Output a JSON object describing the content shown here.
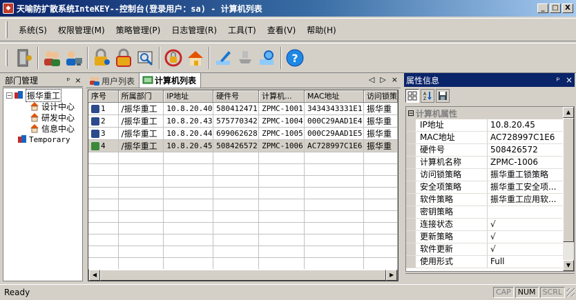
{
  "window": {
    "title": "天喻防扩散系统InteKEY--控制台(登录用户：sa) - 计算机列表",
    "minimize": "_",
    "maximize": "□",
    "close": "X"
  },
  "menu": {
    "items": [
      "系统(S)",
      "权限管理(M)",
      "策略管理(P)",
      "日志管理(R)",
      "工具(T)",
      "查看(V)",
      "帮助(H)"
    ]
  },
  "toolbar": {
    "icons": [
      "door-exit-icon",
      "users-icon",
      "user-computer-icon",
      "lock-key-icon",
      "lock-icon",
      "key-search-icon",
      "lock-refresh-icon",
      "home-lock-icon",
      "pen-edit-icon",
      "stamp-icon",
      "stamp-search-icon",
      "help-icon"
    ]
  },
  "dept_panel": {
    "title": "部门管理",
    "pin": "ᵖ",
    "close": "×",
    "tree": {
      "root": "振华重工",
      "children": [
        "设计中心",
        "研发中心",
        "信息中心"
      ],
      "other": "Temporary"
    }
  },
  "tabs": {
    "items": [
      {
        "label": "用户列表",
        "active": false
      },
      {
        "label": "计算机列表",
        "active": true
      }
    ],
    "nav_prev": "◁",
    "nav_next": "▷",
    "nav_close": "×"
  },
  "grid": {
    "columns": [
      "序号",
      "所属部门",
      "IP地址",
      "硬件号",
      "计算机...",
      "MAC地址",
      "访问锁策"
    ],
    "rows": [
      {
        "no": "1",
        "dept": "/振华重工",
        "ip": "10.8.20.40",
        "hw": "580412471",
        "pc": "ZPMC-1001",
        "mac": "3434343331E1",
        "lock": "振华重",
        "icon": "blue",
        "selected": false
      },
      {
        "no": "2",
        "dept": "/振华重工",
        "ip": "10.8.20.43",
        "hw": "575770342",
        "pc": "ZPMC-1004",
        "mac": "000C29AAD1E4",
        "lock": "振华重",
        "icon": "blue",
        "selected": false
      },
      {
        "no": "3",
        "dept": "/振华重工",
        "ip": "10.8.20.44",
        "hw": "699062628",
        "pc": "ZPMC-1005",
        "mac": "000C29AAD1E5",
        "lock": "振华重",
        "icon": "blue",
        "selected": false
      },
      {
        "no": "4",
        "dept": "/振华重工",
        "ip": "10.8.20.45",
        "hw": "508426572",
        "pc": "ZPMC-1006",
        "mac": "AC728997C1E6",
        "lock": "振华重",
        "icon": "green",
        "selected": true
      }
    ]
  },
  "props": {
    "title": "属性信息",
    "pin": "ᵖ",
    "close": "×",
    "category": "计算机属性",
    "rows": [
      {
        "name": "IP地址",
        "value": "10.8.20.45"
      },
      {
        "name": "MAC地址",
        "value": "AC728997C1E6"
      },
      {
        "name": "硬件号",
        "value": "508426572"
      },
      {
        "name": "计算机名称",
        "value": "ZPMC-1006"
      },
      {
        "name": "访问锁策略",
        "value": "振华重工锁策略"
      },
      {
        "name": "安全项策略",
        "value": "振华重工安全项..."
      },
      {
        "name": "软件策略",
        "value": "振华重工应用软..."
      },
      {
        "name": "密钥策略",
        "value": ""
      },
      {
        "name": "连接状态",
        "value": "√"
      },
      {
        "name": "更新策略",
        "value": "√"
      },
      {
        "name": "软件更新",
        "value": "√"
      },
      {
        "name": "使用形式",
        "value": "Full"
      }
    ]
  },
  "status": {
    "text": "Ready",
    "caps": "CAP",
    "num": "NUM",
    "scrl": "SCRL"
  }
}
